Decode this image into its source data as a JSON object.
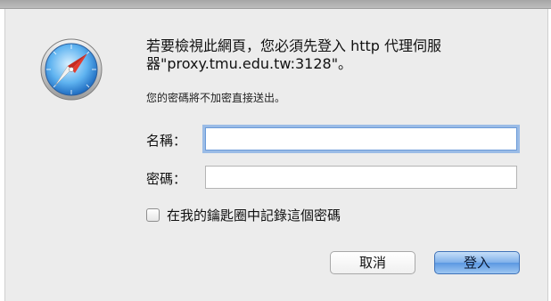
{
  "dialog": {
    "message": "若要檢視此網頁，您必須先登入 http 代理伺服\n器\"proxy.tmu.edu.tw:3128\"。",
    "info": "您的密碼將不加密直接送出。",
    "icon": "safari-compass-icon"
  },
  "form": {
    "username_label": "名稱：",
    "username_value": "",
    "password_label": "密碼：",
    "password_value": "",
    "remember_label": "在我的鑰匙圈中記錄這個密碼",
    "remember_checked": false
  },
  "buttons": {
    "cancel_label": "取消",
    "login_label": "登入"
  },
  "colors": {
    "focus_ring": "#5a96e1",
    "default_button": "#5b98e2"
  }
}
